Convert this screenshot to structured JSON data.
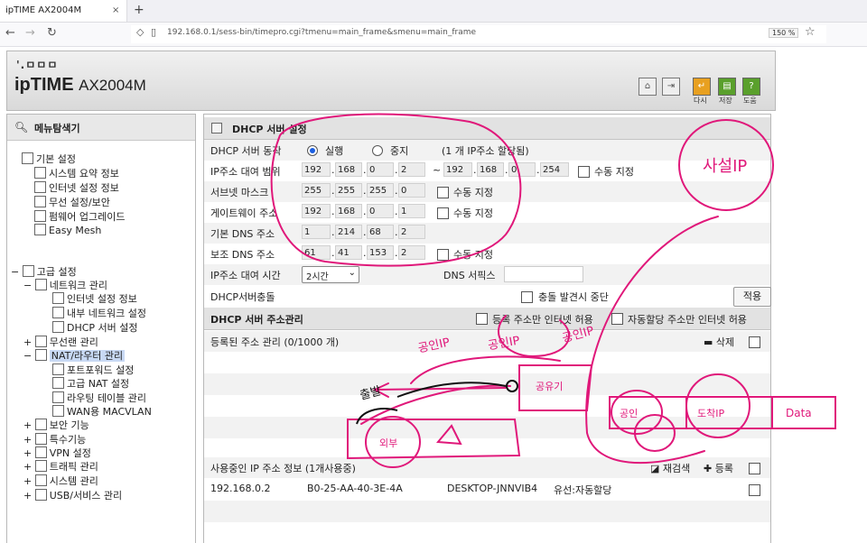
{
  "browser": {
    "tab_title": "ipTIME AX2004M",
    "tab_close": "×",
    "new_tab": "+",
    "url": "192.168.0.1/sess-bin/timepro.cgi?tmenu=main_frame&smenu=main_frame",
    "zoom": "150 %"
  },
  "header": {
    "logo_dots": "'.ㅁㅁㅁ",
    "brand": "ipTIME",
    "model": "AX2004M",
    "buttons": [
      {
        "label": "다시",
        "color": "#e8a020"
      },
      {
        "label": "저장",
        "color": "#5aa02c"
      },
      {
        "label": "도움",
        "color": "#5aa02c"
      }
    ]
  },
  "sidebar": {
    "title": "메뉴탐색기",
    "basic": {
      "label": "기본 설정",
      "items": [
        "시스템 요약 정보",
        "인터넷 설정 정보",
        "무선 설정/보안",
        "펌웨어 업그레이드",
        "Easy Mesh"
      ]
    },
    "advanced": {
      "label": "고급 설정",
      "network": "네트워크 관리",
      "network_items": [
        "인터넷 설정 정보",
        "내부 네트워크 설정",
        "DHCP 서버 설정"
      ],
      "wireless": "무선랜 관리",
      "nat": "NAT/라우터 관리",
      "nat_items": [
        "포트포워드 설정",
        "고급 NAT 설정",
        "라우팅 테이블 관리",
        "WAN용 MACVLAN"
      ],
      "others": [
        "보안 기능",
        "특수기능",
        "VPN 설정",
        "트래픽 관리",
        "시스템 관리",
        "USB/서비스 관리"
      ]
    },
    "expanders": {
      "minus": "−",
      "plus": "+"
    }
  },
  "dhcp": {
    "title": "DHCP 서버 설정",
    "status_label": "DHCP 서버 동작",
    "run": "실행",
    "stop": "중지",
    "assign_note": "(1 개 IP주소 할당됨)",
    "range_label": "IP주소 대여 범위",
    "range_start": [
      "192",
      "168",
      "0",
      "2"
    ],
    "range_sep": "~",
    "range_end": [
      "192",
      "168",
      "0",
      "254"
    ],
    "manual": "수동 지정",
    "subnet_label": "서브넷 마스크",
    "subnet": [
      "255",
      "255",
      "255",
      "0"
    ],
    "gateway_label": "게이트웨이 주소",
    "gateway": [
      "192",
      "168",
      "0",
      "1"
    ],
    "dns1_label": "기본 DNS 주소",
    "dns1": [
      "1",
      "214",
      "68",
      "2"
    ],
    "dns2_label": "보조 DNS 주소",
    "dns2": [
      "61",
      "41",
      "153",
      "2"
    ],
    "lease_label": "IP주소 대여 시간",
    "lease_value": "2시간",
    "dns_suffix_label": "DNS 서픽스",
    "conflict_label": "DHCP서버충돌",
    "conflict_stop": "충돌 발견시 중단",
    "apply": "적용"
  },
  "address_mgmt": {
    "title": "DHCP 서버 주소관리",
    "reg_only": "등록 주소만 인터넷 허용",
    "auto_only": "자동할당 주소만 인터넷 허용",
    "registered": "등록된 주소 관리 (0/1000 개)",
    "delete": "삭제",
    "in_use": "사용중인 IP 주소 정보 (1개사용중)",
    "rescan": "재검색",
    "register": "등록",
    "leases": [
      {
        "ip": "192.168.0.2",
        "mac": "B0-25-AA-40-3E-4A",
        "host": "DESKTOP-JNNVIB4",
        "type": "유선:자동할당"
      }
    ]
  },
  "annotations": {
    "private": "사설IP",
    "public_1": "공인IP",
    "public_2": "공인IP",
    "public_3": "공인IP",
    "public_4": "공인",
    "header_1": "출발",
    "header_2": "도착IP",
    "data": "Data",
    "router": "공유기",
    "internet": "외부"
  }
}
